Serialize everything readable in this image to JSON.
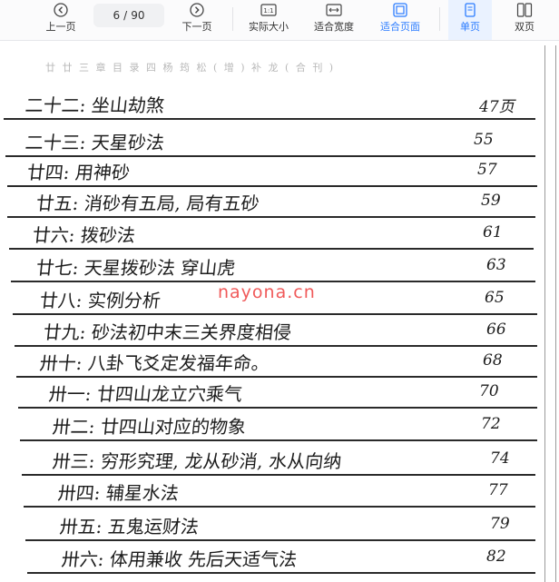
{
  "toolbar": {
    "prev_label": "上一页",
    "next_label": "下一页",
    "page_current": "6",
    "page_sep": "/",
    "page_total": "90",
    "actual_size_label": "实际大小",
    "actual_size_icon_text": "1:1",
    "fit_width_label": "适合宽度",
    "fit_page_label": "适合页面",
    "single_label": "单页",
    "double_label": "双页",
    "accent_color": "#2b7cff"
  },
  "document": {
    "header_faint": "廿 廿 三 章  目 录 四  杨 筠  松 ( 增 ) 补  龙 ( 合 刊 )",
    "watermark": "nayona.cn",
    "entries": [
      {
        "label": "二十二: 坐山劫煞",
        "page": "47页"
      },
      {
        "label": "二十三: 天星砂法",
        "page": "55"
      },
      {
        "label": "廿四: 用神砂",
        "page": "57"
      },
      {
        "label": "廿五: 消砂有五局, 局有五砂",
        "page": "59"
      },
      {
        "label": "廿六: 拨砂法",
        "page": "61"
      },
      {
        "label": "廿七: 天星拨砂法  穿山虎",
        "page": "63"
      },
      {
        "label": "廿八: 实例分析",
        "page": "65"
      },
      {
        "label": "廿九: 砂法初中末三关界度相侵",
        "page": "66"
      },
      {
        "label": "卅十: 八卦飞爻定发福年命。",
        "page": "68"
      },
      {
        "label": "卅一: 廿四山龙立穴乘气",
        "page": "70"
      },
      {
        "label": "卅二: 廿四山对应的物象",
        "page": "72"
      },
      {
        "label": "卅三: 穷形究理, 龙从砂消, 水从向纳",
        "page": "74"
      },
      {
        "label": "卅四: 辅星水法",
        "page": "77"
      },
      {
        "label": "卅五: 五鬼运财法",
        "page": "79"
      },
      {
        "label": "卅六: 体用兼收 先后天适气法",
        "page": "82"
      }
    ]
  }
}
